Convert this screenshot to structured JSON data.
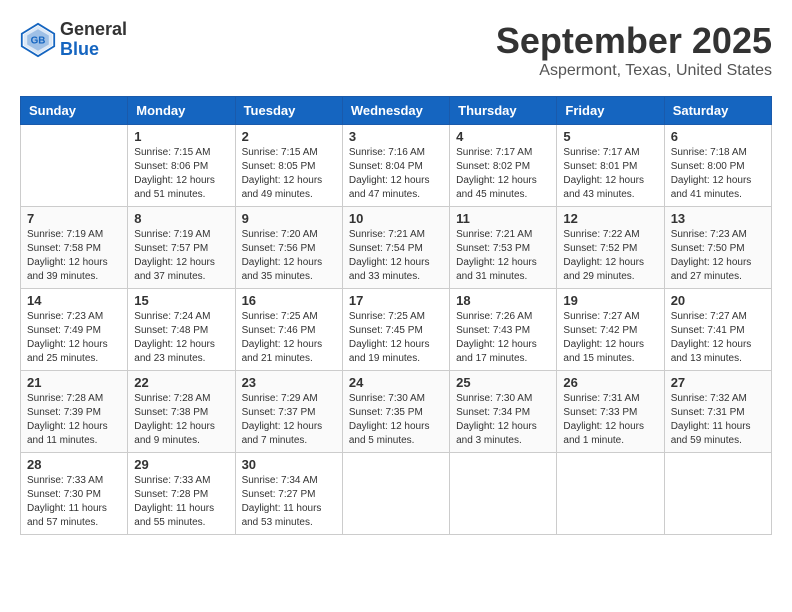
{
  "header": {
    "logo": {
      "general": "General",
      "blue": "Blue"
    },
    "title": "September 2025",
    "location": "Aspermont, Texas, United States"
  },
  "weekdays": [
    "Sunday",
    "Monday",
    "Tuesday",
    "Wednesday",
    "Thursday",
    "Friday",
    "Saturday"
  ],
  "weeks": [
    [
      {
        "day": null,
        "info": null
      },
      {
        "day": 1,
        "info": "Sunrise: 7:15 AM\nSunset: 8:06 PM\nDaylight: 12 hours\nand 51 minutes."
      },
      {
        "day": 2,
        "info": "Sunrise: 7:15 AM\nSunset: 8:05 PM\nDaylight: 12 hours\nand 49 minutes."
      },
      {
        "day": 3,
        "info": "Sunrise: 7:16 AM\nSunset: 8:04 PM\nDaylight: 12 hours\nand 47 minutes."
      },
      {
        "day": 4,
        "info": "Sunrise: 7:17 AM\nSunset: 8:02 PM\nDaylight: 12 hours\nand 45 minutes."
      },
      {
        "day": 5,
        "info": "Sunrise: 7:17 AM\nSunset: 8:01 PM\nDaylight: 12 hours\nand 43 minutes."
      },
      {
        "day": 6,
        "info": "Sunrise: 7:18 AM\nSunset: 8:00 PM\nDaylight: 12 hours\nand 41 minutes."
      }
    ],
    [
      {
        "day": 7,
        "info": "Sunrise: 7:19 AM\nSunset: 7:58 PM\nDaylight: 12 hours\nand 39 minutes."
      },
      {
        "day": 8,
        "info": "Sunrise: 7:19 AM\nSunset: 7:57 PM\nDaylight: 12 hours\nand 37 minutes."
      },
      {
        "day": 9,
        "info": "Sunrise: 7:20 AM\nSunset: 7:56 PM\nDaylight: 12 hours\nand 35 minutes."
      },
      {
        "day": 10,
        "info": "Sunrise: 7:21 AM\nSunset: 7:54 PM\nDaylight: 12 hours\nand 33 minutes."
      },
      {
        "day": 11,
        "info": "Sunrise: 7:21 AM\nSunset: 7:53 PM\nDaylight: 12 hours\nand 31 minutes."
      },
      {
        "day": 12,
        "info": "Sunrise: 7:22 AM\nSunset: 7:52 PM\nDaylight: 12 hours\nand 29 minutes."
      },
      {
        "day": 13,
        "info": "Sunrise: 7:23 AM\nSunset: 7:50 PM\nDaylight: 12 hours\nand 27 minutes."
      }
    ],
    [
      {
        "day": 14,
        "info": "Sunrise: 7:23 AM\nSunset: 7:49 PM\nDaylight: 12 hours\nand 25 minutes."
      },
      {
        "day": 15,
        "info": "Sunrise: 7:24 AM\nSunset: 7:48 PM\nDaylight: 12 hours\nand 23 minutes."
      },
      {
        "day": 16,
        "info": "Sunrise: 7:25 AM\nSunset: 7:46 PM\nDaylight: 12 hours\nand 21 minutes."
      },
      {
        "day": 17,
        "info": "Sunrise: 7:25 AM\nSunset: 7:45 PM\nDaylight: 12 hours\nand 19 minutes."
      },
      {
        "day": 18,
        "info": "Sunrise: 7:26 AM\nSunset: 7:43 PM\nDaylight: 12 hours\nand 17 minutes."
      },
      {
        "day": 19,
        "info": "Sunrise: 7:27 AM\nSunset: 7:42 PM\nDaylight: 12 hours\nand 15 minutes."
      },
      {
        "day": 20,
        "info": "Sunrise: 7:27 AM\nSunset: 7:41 PM\nDaylight: 12 hours\nand 13 minutes."
      }
    ],
    [
      {
        "day": 21,
        "info": "Sunrise: 7:28 AM\nSunset: 7:39 PM\nDaylight: 12 hours\nand 11 minutes."
      },
      {
        "day": 22,
        "info": "Sunrise: 7:28 AM\nSunset: 7:38 PM\nDaylight: 12 hours\nand 9 minutes."
      },
      {
        "day": 23,
        "info": "Sunrise: 7:29 AM\nSunset: 7:37 PM\nDaylight: 12 hours\nand 7 minutes."
      },
      {
        "day": 24,
        "info": "Sunrise: 7:30 AM\nSunset: 7:35 PM\nDaylight: 12 hours\nand 5 minutes."
      },
      {
        "day": 25,
        "info": "Sunrise: 7:30 AM\nSunset: 7:34 PM\nDaylight: 12 hours\nand 3 minutes."
      },
      {
        "day": 26,
        "info": "Sunrise: 7:31 AM\nSunset: 7:33 PM\nDaylight: 12 hours\nand 1 minute."
      },
      {
        "day": 27,
        "info": "Sunrise: 7:32 AM\nSunset: 7:31 PM\nDaylight: 11 hours\nand 59 minutes."
      }
    ],
    [
      {
        "day": 28,
        "info": "Sunrise: 7:33 AM\nSunset: 7:30 PM\nDaylight: 11 hours\nand 57 minutes."
      },
      {
        "day": 29,
        "info": "Sunrise: 7:33 AM\nSunset: 7:28 PM\nDaylight: 11 hours\nand 55 minutes."
      },
      {
        "day": 30,
        "info": "Sunrise: 7:34 AM\nSunset: 7:27 PM\nDaylight: 11 hours\nand 53 minutes."
      },
      {
        "day": null,
        "info": null
      },
      {
        "day": null,
        "info": null
      },
      {
        "day": null,
        "info": null
      },
      {
        "day": null,
        "info": null
      }
    ]
  ]
}
